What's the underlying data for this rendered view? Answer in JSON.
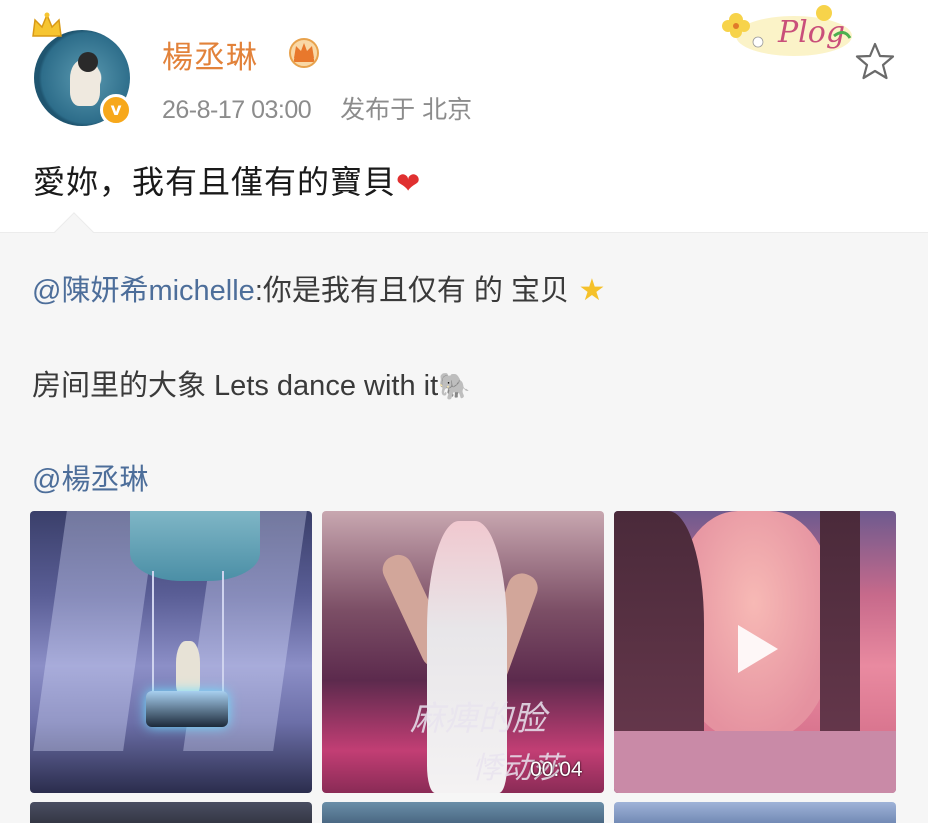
{
  "post": {
    "username": "楊丞琳",
    "timestamp": "26-8-17 03:00",
    "location": "发布于 北京",
    "text": "愛妳，我有且僅有的寶貝",
    "badge_text": "Plog",
    "icons": {
      "avatar_crown": "crown-icon",
      "verified": "verified-badge-icon",
      "verified_letter": "v",
      "vip": "vip-crown-icon",
      "favorite": "star-outline-icon",
      "heart": "red-heart-emoji"
    },
    "colors": {
      "username": "#e2823a",
      "meta": "#8c8c8c",
      "mention": "#4d6e9a",
      "verified": "#f7a81b"
    }
  },
  "repost": {
    "mention1": "@陳妍希michelle",
    "line1_text": ":你是我有且仅有 的 宝贝",
    "line2_text": "房间里的大象 Lets dance with it",
    "mention2": "@楊丞琳",
    "media": [
      {
        "kind": "image",
        "name": "stage-swing-photo"
      },
      {
        "kind": "video",
        "name": "dance-video",
        "duration": "00:04",
        "caption_line1": "麻痺的脸",
        "caption_line2": "悸动莎"
      },
      {
        "kind": "video",
        "name": "selfie-video",
        "icon": "play-icon"
      },
      {
        "kind": "image",
        "name": "row2-image-1"
      },
      {
        "kind": "image",
        "name": "row2-image-2"
      },
      {
        "kind": "image",
        "name": "row2-image-3"
      }
    ]
  }
}
